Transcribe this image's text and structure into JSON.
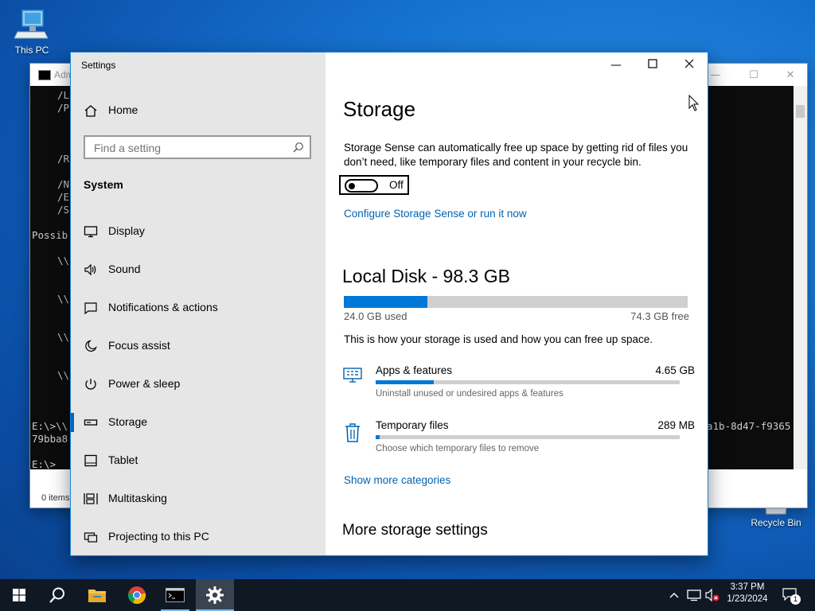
{
  "desktop": {
    "this_pc_label": "This PC",
    "recycle_bin_label": "Recycle Bin"
  },
  "console": {
    "title": "Adm",
    "lines": [
      "/L",
      "/P",
      "/R",
      "/N",
      "/E",
      "/S",
      "Possib",
      "\\\\",
      "\\\\",
      "\\\\",
      "\\\\",
      "E:\\>\\\\",
      "79bba8",
      "E:\\>",
      "a1b-8d47-f9365"
    ],
    "footer": "0 items"
  },
  "settings": {
    "app_title": "Settings",
    "nav": {
      "home": "Home",
      "search_placeholder": "Find a setting",
      "section": "System",
      "items": [
        {
          "label": "Display",
          "icon": "display-icon"
        },
        {
          "label": "Sound",
          "icon": "sound-icon"
        },
        {
          "label": "Notifications & actions",
          "icon": "notifications-icon"
        },
        {
          "label": "Focus assist",
          "icon": "focus-assist-icon"
        },
        {
          "label": "Power & sleep",
          "icon": "power-icon"
        },
        {
          "label": "Storage",
          "icon": "storage-icon",
          "active": true
        },
        {
          "label": "Tablet",
          "icon": "tablet-icon"
        },
        {
          "label": "Multitasking",
          "icon": "multitasking-icon"
        },
        {
          "label": "Projecting to this PC",
          "icon": "projecting-icon"
        }
      ]
    },
    "page": {
      "title": "Storage",
      "sense_description": "Storage Sense can automatically free up space by getting rid of files you don’t need, like temporary files and content in your recycle bin.",
      "toggle_state": "Off",
      "configure_link": "Configure Storage Sense or run it now",
      "disk_title": "Local Disk - 98.3 GB",
      "disk_used": "24.0 GB used",
      "disk_free": "74.3 GB free",
      "disk_used_fraction": 0.244,
      "usage_intro": "This is how your storage is used and how you can free up space.",
      "categories": [
        {
          "name": "Apps & features",
          "size": "4.65 GB",
          "desc": "Uninstall unused or undesired apps & features",
          "fraction": 0.19,
          "icon": "apps-features-icon"
        },
        {
          "name": "Temporary files",
          "size": "289 MB",
          "desc": "Choose which temporary files to remove",
          "fraction": 0.012,
          "icon": "trash-icon"
        }
      ],
      "show_more_link": "Show more categories",
      "more_settings_heading": "More storage settings"
    }
  },
  "taskbar": {
    "time": "3:37 PM",
    "date": "1/23/2024",
    "notification_count": "1",
    "accent_color": "#76b9ed"
  }
}
